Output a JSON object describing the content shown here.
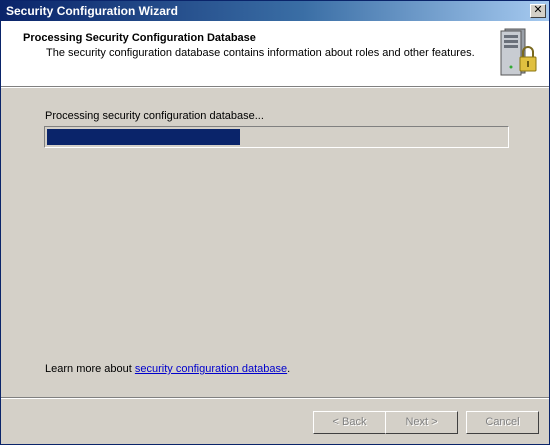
{
  "window": {
    "title": "Security Configuration Wizard",
    "close_glyph": "✕"
  },
  "header": {
    "title": "Processing Security Configuration Database",
    "subtitle": "The security configuration database contains information about roles and other features.",
    "icon": "server-lock-icon"
  },
  "main": {
    "status_text": "Processing security configuration database...",
    "progress_percent": 42,
    "learn_prefix": "Learn more about ",
    "learn_link": "security configuration database",
    "learn_suffix": "."
  },
  "buttons": {
    "back": "< Back",
    "next": "Next >",
    "cancel": "Cancel"
  },
  "colors": {
    "titlebar": "#0a246a",
    "progress_fill": "#0a246a",
    "dialog_bg": "#d4d0c8",
    "link": "#0000cc"
  }
}
